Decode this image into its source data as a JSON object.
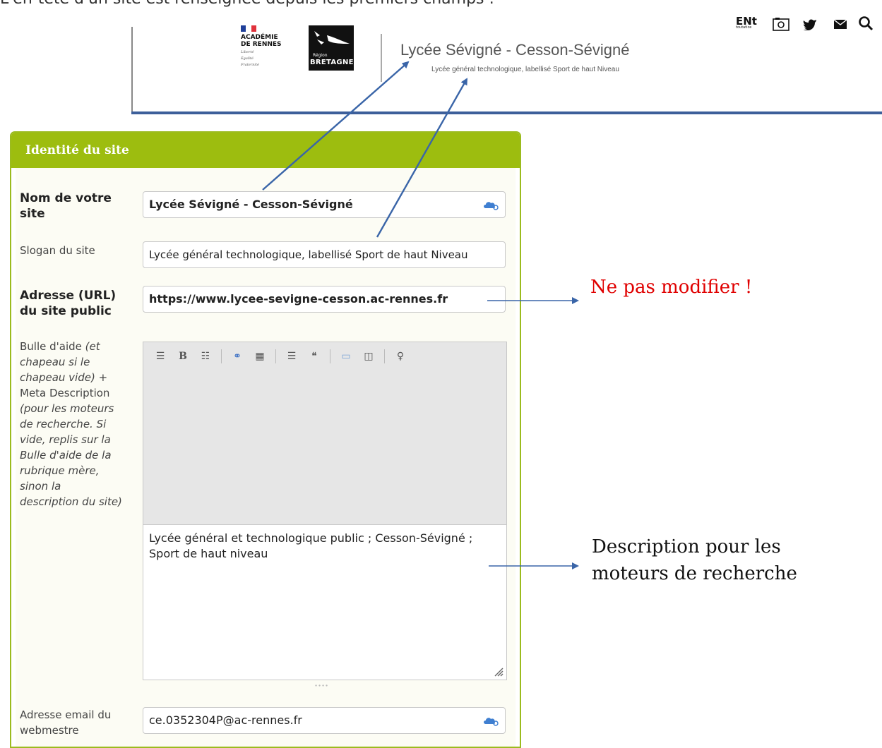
{
  "intro_text": "L'en-tête d'un site est renseignée depuis les premiers champs :",
  "header": {
    "academy_lines": [
      "ACADÉMIE",
      "DE RENNES"
    ],
    "academy_motto": [
      "Liberté",
      "Égalité",
      "Fraternité"
    ],
    "region_word": "Région",
    "region_name": "BRETAGNE",
    "site_title": "Lycée Sévigné - Cesson-Sévigné",
    "site_slogan": "Lycée général technologique, labellisé Sport de haut Niveau",
    "ent_label": "ENt",
    "ent_sub": "toutatice",
    "icons": [
      "ent-icon",
      "camera-icon",
      "twitter-icon",
      "mail-icon",
      "search-icon"
    ]
  },
  "panel": {
    "title": "Identité du site",
    "fields": {
      "name_label_1": "Nom de votre",
      "name_label_2": "site",
      "name_value": "Lycée Sévigné - Cesson-Sévigné",
      "slogan_label": "Slogan du site",
      "slogan_value": "Lycée général technologique, labellisé Sport de haut Niveau",
      "url_label_1": "Adresse (URL)",
      "url_label_2": "du site public",
      "url_value": "https://www.lycee-sevigne-cesson.ac-rennes.fr",
      "help_label": [
        "Bulle d'aide ",
        "(et",
        "chapeau si le",
        "chapeau vide)",
        " +",
        "Meta Description",
        "(pour les moteurs",
        "de recherche. Si",
        "vide, replis sur la",
        "Bulle d'aide de la",
        "rubrique mère,",
        "sinon la",
        "description du site)"
      ],
      "description_value_1": "Lycée général et technologique public ; Cesson-Sévigné ;",
      "description_value_2": "Sport de haut niveau",
      "email_label_1": "Adresse email du",
      "email_label_2": "webmestre",
      "email_value": "ce.0352304P@ac-rennes.fr"
    }
  },
  "annotations": {
    "do_not_modify": "Ne pas modifier !",
    "description_1": "Description pour les",
    "description_2": "moteurs de recherche"
  },
  "colors": {
    "panel_green": "#9dbd0f",
    "header_blue": "#3d5f9a",
    "arrow_blue": "#3a65a8",
    "warning_red": "#e00000"
  }
}
